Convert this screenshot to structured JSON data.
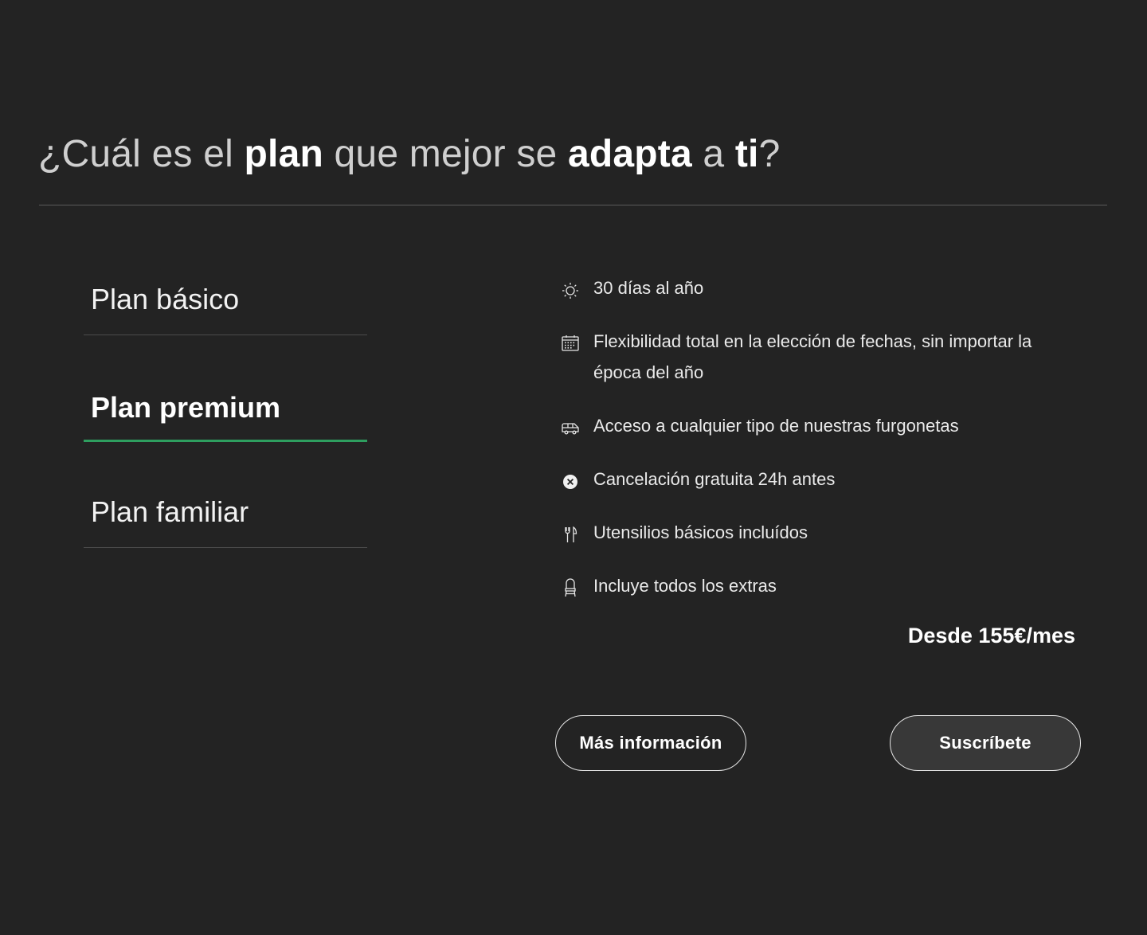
{
  "header": {
    "title_parts": {
      "p1": "¿Cuál es el ",
      "b1": "plan",
      "p2": " que mejor se ",
      "b2": "adapta",
      "p3": " a ",
      "b3": "ti",
      "p4": "?"
    }
  },
  "plans": {
    "tabs": [
      {
        "label": "Plan básico"
      },
      {
        "label": "Plan premium"
      },
      {
        "label": "Plan familiar"
      }
    ],
    "active": "Plan premium",
    "accent_color": "#2e9e5f"
  },
  "features": [
    {
      "icon": "sun-icon",
      "text": "30 días al año"
    },
    {
      "icon": "calendar-icon",
      "text": "Flexibilidad total en la elección de fechas, sin importar la época del año"
    },
    {
      "icon": "van-icon",
      "text": "Acceso a cualquier tipo de nuestras furgonetas"
    },
    {
      "icon": "cancel-circle-icon",
      "text": "Cancelación gratuita 24h antes"
    },
    {
      "icon": "utensils-icon",
      "text": "Utensilios básicos incluídos"
    },
    {
      "icon": "chair-icon",
      "text": "Incluye todos los extras"
    }
  ],
  "price": "Desde 155€/mes",
  "buttons": {
    "info_label": "Más información",
    "subscribe_label": "Suscríbete"
  },
  "colors": {
    "background": "#232323",
    "text": "#ffffff"
  }
}
